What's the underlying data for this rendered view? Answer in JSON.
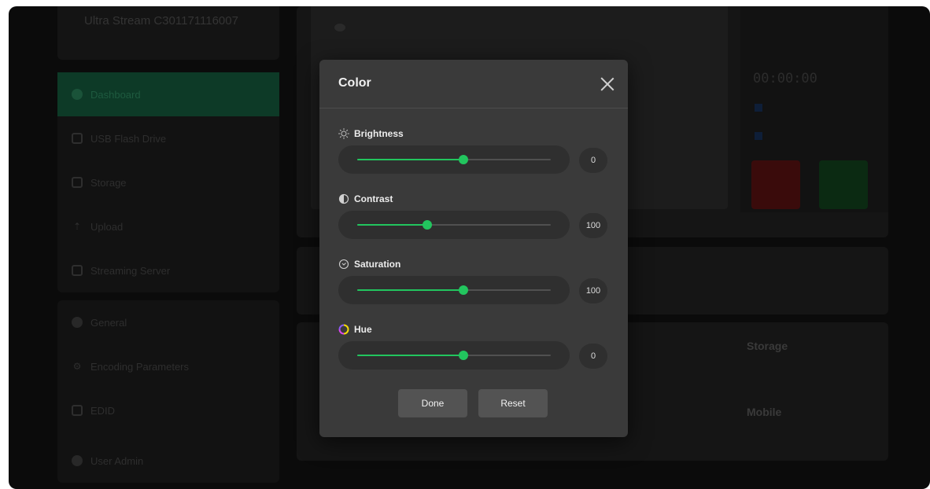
{
  "sidebar": {
    "device_name": "Ultra Stream C301171116007",
    "nav_primary": [
      {
        "label": "Dashboard",
        "icon": "dashboard-icon",
        "active": true
      },
      {
        "label": "USB Flash Drive",
        "icon": "usb-icon",
        "active": false
      },
      {
        "label": "Storage",
        "icon": "storage-icon",
        "active": false
      },
      {
        "label": "Upload",
        "icon": "upload-icon",
        "active": false
      },
      {
        "label": "Streaming Server",
        "icon": "server-icon",
        "active": false
      }
    ],
    "nav_secondary": [
      {
        "label": "General",
        "icon": "gear-icon"
      },
      {
        "label": "Encoding Parameters",
        "icon": "encoding-icon"
      },
      {
        "label": "EDID",
        "icon": "edid-icon"
      },
      {
        "label": "User Admin",
        "icon": "user-icon"
      }
    ]
  },
  "status": {
    "timer": "00:00:00",
    "storage_label": "Storage",
    "mobile_label": "Mobile"
  },
  "modal": {
    "title": "Color",
    "controls": [
      {
        "label": "Brightness",
        "icon": "brightness-icon",
        "value": "0",
        "level": 0.55
      },
      {
        "label": "Contrast",
        "icon": "contrast-icon",
        "value": "100",
        "level": 0.36
      },
      {
        "label": "Saturation",
        "icon": "saturation-icon",
        "value": "100",
        "level": 0.55
      },
      {
        "label": "Hue",
        "icon": "hue-icon",
        "value": "0",
        "level": 0.55
      }
    ],
    "done_label": "Done",
    "reset_label": "Reset"
  },
  "colors": {
    "accent": "#22c55e",
    "modal_bg": "#3a3a3a",
    "active_nav": "#0d3a27"
  }
}
